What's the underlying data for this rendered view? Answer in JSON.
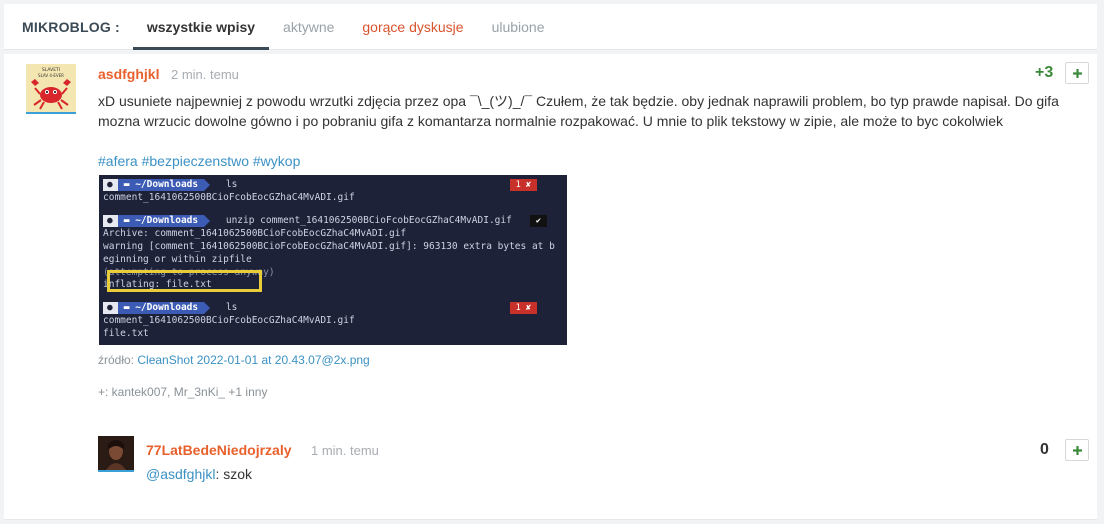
{
  "nav": {
    "brand": "MIKROBLOG :",
    "tabs": [
      {
        "label": "wszystkie wpisy",
        "active": true
      },
      {
        "label": "aktywne",
        "active": false
      },
      {
        "label": "gorące dyskusje",
        "active": false
      },
      {
        "label": "ulubione",
        "active": false
      }
    ]
  },
  "post": {
    "author": "asdfghjkl",
    "time": "2 min. temu",
    "votes": "+3",
    "plus_label": "+",
    "avatar_text": [
      "SLAVETI",
      "SLAV  4-EVER"
    ],
    "text": "xD usuniete najpewniej z powodu wrzutki zdjęcia przez opa ¯\\_(ツ)_/¯ Czułem, że tak będzie. oby jednak naprawili problem, bo typ prawde napisał. Do gifa mozna wrzucic dowolne gówno i po pobraniu gifa z komantarza normalnie rozpakować. U mnie to plik tekstowy w zipie, ale może to byc cokolwiek",
    "tags": [
      "#afera",
      "#bezpieczenstwo",
      "#wykop"
    ],
    "terminal": {
      "path": "~/Downloads",
      "cmd1": "ls",
      "out1": "comment_1641062500BCioFcobEocGZhaC4MvADI.gif",
      "err1": "1 ✘",
      "cmd2": "unzip comment_1641062500BCioFcobEocGZhaC4MvADI.gif",
      "ok2": "✔",
      "out2a": "Archive:  comment_1641062500BCioFcobEocGZhaC4MvADI.gif",
      "out2b": "warning [comment_1641062500BCioFcobEocGZhaC4MvADI.gif]:  963130 extra bytes at b",
      "out2c": "eginning or within zipfile",
      "out2d": "  (attempting to process anyway)",
      "out2e": "  inflating: file.txt",
      "cmd3": "ls",
      "err3": "1 ✘",
      "out3a": "comment_1641062500BCioFcobEocGZhaC4MvADI.gif",
      "out3b": "file.txt"
    },
    "source_label": "źródło:",
    "source_link": "CleanShot 2022-01-01 at 20.43.07@2x.png",
    "voters": "+: kantek007, Mr_3nKi_ +1 inny"
  },
  "reply": {
    "author": "77LatBedeNiedojrzaly",
    "time": "1 min. temu",
    "votes": "0",
    "plus_label": "+",
    "mention": "@asdfghjkl",
    "text": ": szok"
  },
  "colors": {
    "accent_orange": "#e8602c",
    "link_blue": "#3b91c4",
    "vote_green": "#3c8a3c",
    "hot_tab": "#d9532e"
  }
}
